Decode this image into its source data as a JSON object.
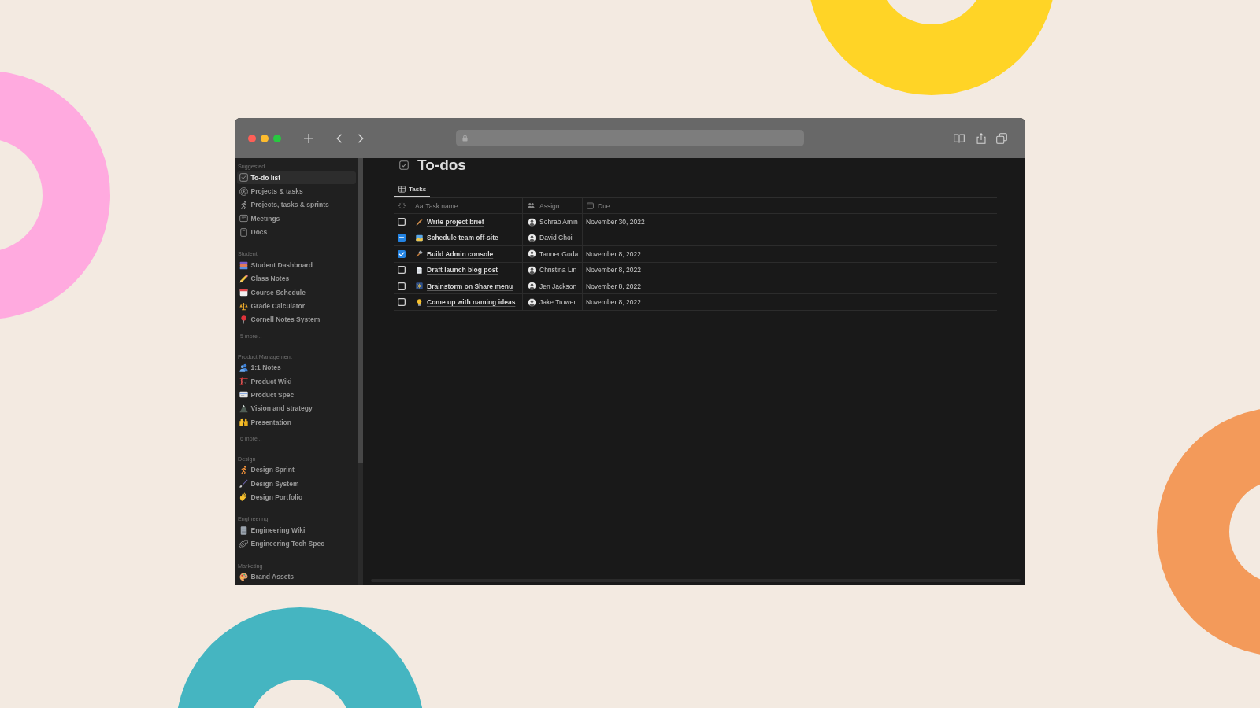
{
  "sidebar": {
    "sections": [
      {
        "title": "Suggested",
        "items": [
          {
            "label": "To-do list",
            "selected": true
          },
          {
            "label": "Projects & tasks",
            "selected": false
          },
          {
            "label": "Projects, tasks & sprints",
            "selected": false
          },
          {
            "label": "Meetings",
            "selected": false
          },
          {
            "label": "Docs",
            "selected": false
          }
        ]
      },
      {
        "title": "Student",
        "items": [
          {
            "label": "Student Dashboard",
            "selected": false
          },
          {
            "label": "Class Notes",
            "selected": false
          },
          {
            "label": "Course Schedule",
            "selected": false
          },
          {
            "label": "Grade Calculator",
            "selected": false
          },
          {
            "label": "Cornell Notes System",
            "selected": false
          }
        ],
        "more": "5 more..."
      },
      {
        "title": "Product Management",
        "items": [
          {
            "label": "1:1 Notes",
            "selected": false
          },
          {
            "label": "Product Wiki",
            "selected": false
          },
          {
            "label": "Product Spec",
            "selected": false
          },
          {
            "label": "Vision and strategy",
            "selected": false
          },
          {
            "label": "Presentation",
            "selected": false
          }
        ],
        "more": "6 more..."
      },
      {
        "title": "Design",
        "items": [
          {
            "label": "Design Sprint",
            "selected": false
          },
          {
            "label": "Design System",
            "selected": false
          },
          {
            "label": "Design Portfolio",
            "selected": false
          }
        ]
      },
      {
        "title": "Engineering",
        "items": [
          {
            "label": "Engineering Wiki",
            "selected": false
          },
          {
            "label": "Engineering Tech Spec",
            "selected": false
          }
        ]
      },
      {
        "title": "Marketing",
        "items": [
          {
            "label": "Brand Assets",
            "selected": false
          }
        ]
      }
    ]
  },
  "page": {
    "title": "To-dos",
    "views": [
      {
        "label": "Tasks",
        "selected": true
      }
    ],
    "table": {
      "columns": [
        {
          "kind": "status"
        },
        {
          "kind": "title",
          "glyph": "Aa",
          "label": "Task name"
        },
        {
          "kind": "person",
          "label": "Assign"
        },
        {
          "kind": "date",
          "label": "Due"
        }
      ],
      "rows": [
        {
          "checked": false,
          "indeterminate": false,
          "task": "Write project brief",
          "assignee": "Sohrab Amin",
          "due": "November 30, 2022"
        },
        {
          "checked": false,
          "indeterminate": true,
          "task": "Schedule team off-site",
          "assignee": "David Choi"
        },
        {
          "checked": true,
          "indeterminate": false,
          "task": "Build Admin console",
          "assignee": "Tanner Goda",
          "due": "November 8, 2022"
        },
        {
          "checked": false,
          "indeterminate": false,
          "task": "Draft launch blog post",
          "assignee": "Christina Lin",
          "due": "November 8, 2022"
        },
        {
          "checked": false,
          "indeterminate": false,
          "task": "Brainstorm on Share menu",
          "assignee": "Jen Jackson",
          "due": "November 8, 2022"
        },
        {
          "checked": false,
          "indeterminate": false,
          "task": "Come up with naming ideas",
          "assignee": "Jake Trower",
          "due": "November 8, 2022"
        }
      ]
    }
  }
}
